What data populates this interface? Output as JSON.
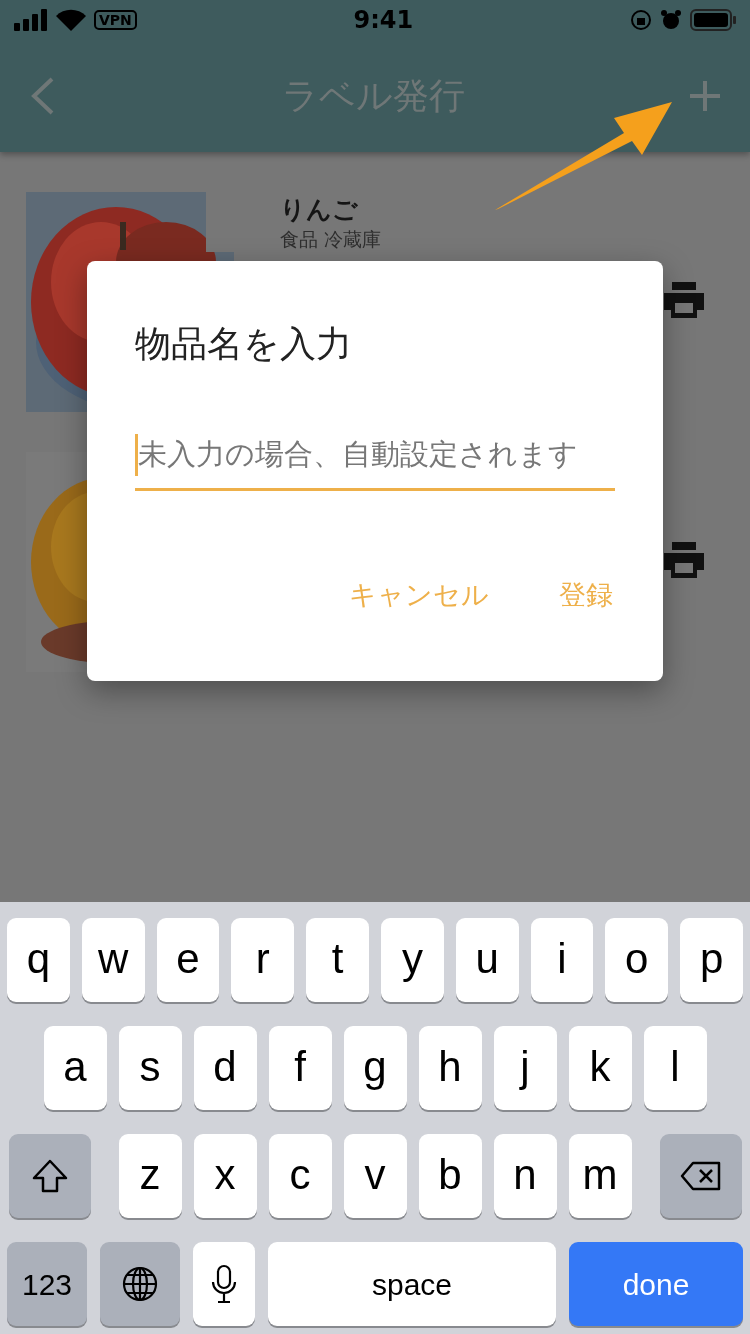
{
  "status_bar": {
    "time": "9:41",
    "vpn": "VPN"
  },
  "nav": {
    "title": "ラベル発行"
  },
  "items": [
    {
      "name": "りんご",
      "category": "食品 冷蔵庫",
      "kind": "picture"
    },
    {
      "kind": "picture"
    }
  ],
  "dialog": {
    "title": "物品名を入力",
    "field": {
      "placeholder": "未入力の場合、自動設定されます",
      "focused": true
    },
    "buttons": [
      "キャンセル",
      "登録"
    ]
  },
  "keyboard": {
    "rows": [
      {
        "keys": [
          {
            "kind": "letter",
            "label": "q"
          },
          {
            "kind": "letter",
            "label": "w"
          },
          {
            "kind": "letter",
            "label": "e"
          },
          {
            "kind": "letter",
            "label": "r"
          },
          {
            "kind": "letter",
            "label": "t"
          },
          {
            "kind": "letter",
            "label": "y"
          },
          {
            "kind": "letter",
            "label": "u"
          },
          {
            "kind": "letter",
            "label": "i"
          },
          {
            "kind": "letter",
            "label": "o"
          },
          {
            "kind": "letter",
            "label": "p"
          }
        ]
      },
      {
        "keys": [
          {
            "kind": "letter",
            "label": "a"
          },
          {
            "kind": "letter",
            "label": "s"
          },
          {
            "kind": "letter",
            "label": "d"
          },
          {
            "kind": "letter",
            "label": "f"
          },
          {
            "kind": "letter",
            "label": "g"
          },
          {
            "kind": "letter",
            "label": "h"
          },
          {
            "kind": "letter",
            "label": "j"
          },
          {
            "kind": "letter",
            "label": "k"
          },
          {
            "kind": "letter",
            "label": "l"
          }
        ]
      },
      {
        "keys": [
          {
            "kind": "shift"
          },
          {
            "kind": "letter",
            "label": "z"
          },
          {
            "kind": "letter",
            "label": "x"
          },
          {
            "kind": "letter",
            "label": "c"
          },
          {
            "kind": "letter",
            "label": "v"
          },
          {
            "kind": "letter",
            "label": "b"
          },
          {
            "kind": "letter",
            "label": "n"
          },
          {
            "kind": "letter",
            "label": "m"
          },
          {
            "kind": "delete"
          }
        ]
      },
      {
        "keys": [
          {
            "kind": "numbers",
            "label": "123"
          },
          {
            "kind": "globe"
          },
          {
            "kind": "mic"
          },
          {
            "kind": "space",
            "label": "space"
          },
          {
            "kind": "done",
            "label": "done"
          }
        ]
      }
    ]
  }
}
